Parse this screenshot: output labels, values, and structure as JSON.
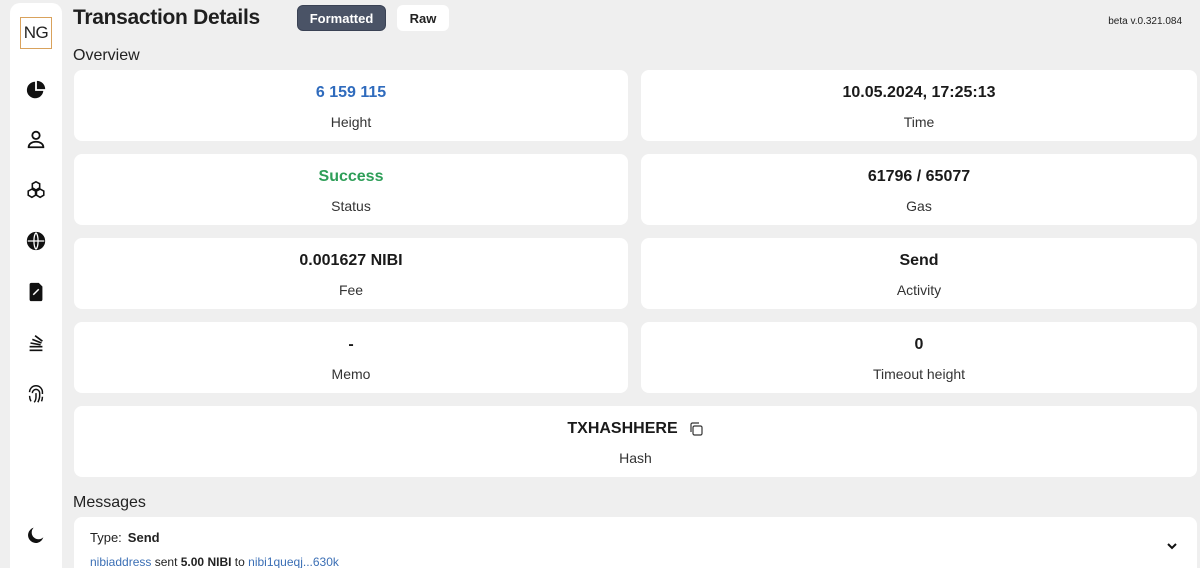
{
  "sidebar": {
    "logo": "NG",
    "icons": [
      "pie-chart-icon",
      "user-icon",
      "blocks-icon",
      "globe-icon",
      "contract-icon",
      "stack-icon",
      "fingerprint-icon",
      "dark-mode-icon"
    ]
  },
  "header": {
    "title": "Transaction Details",
    "tab_formatted": "Formatted",
    "tab_raw": "Raw",
    "version": "beta v.0.321.084"
  },
  "overview": {
    "title": "Overview",
    "height": {
      "value": "6 159 115",
      "label": "Height"
    },
    "time": {
      "value": "10.05.2024, 17:25:13",
      "label": "Time"
    },
    "status": {
      "value": "Success",
      "label": "Status"
    },
    "gas": {
      "value": "61796 / 65077",
      "label": "Gas"
    },
    "fee": {
      "value": "0.001627 NIBI",
      "label": "Fee"
    },
    "activity": {
      "value": "Send",
      "label": "Activity"
    },
    "memo": {
      "value": "-",
      "label": "Memo"
    },
    "timeout": {
      "value": "0",
      "label": "Timeout height"
    },
    "hash": {
      "value": "TXHASHHERE",
      "label": "Hash"
    }
  },
  "messages": {
    "title": "Messages",
    "type_label": "Type:",
    "type_value": "Send",
    "from": "nibiaddress",
    "sent_word": "sent",
    "amount": "5.00 NIBI",
    "to_word": "to",
    "to": "nibi1queqj...630k"
  },
  "colors": {
    "accent_blue": "#2f6bbd",
    "success_green": "#2e9e58",
    "active_tab": "#4a5366"
  }
}
